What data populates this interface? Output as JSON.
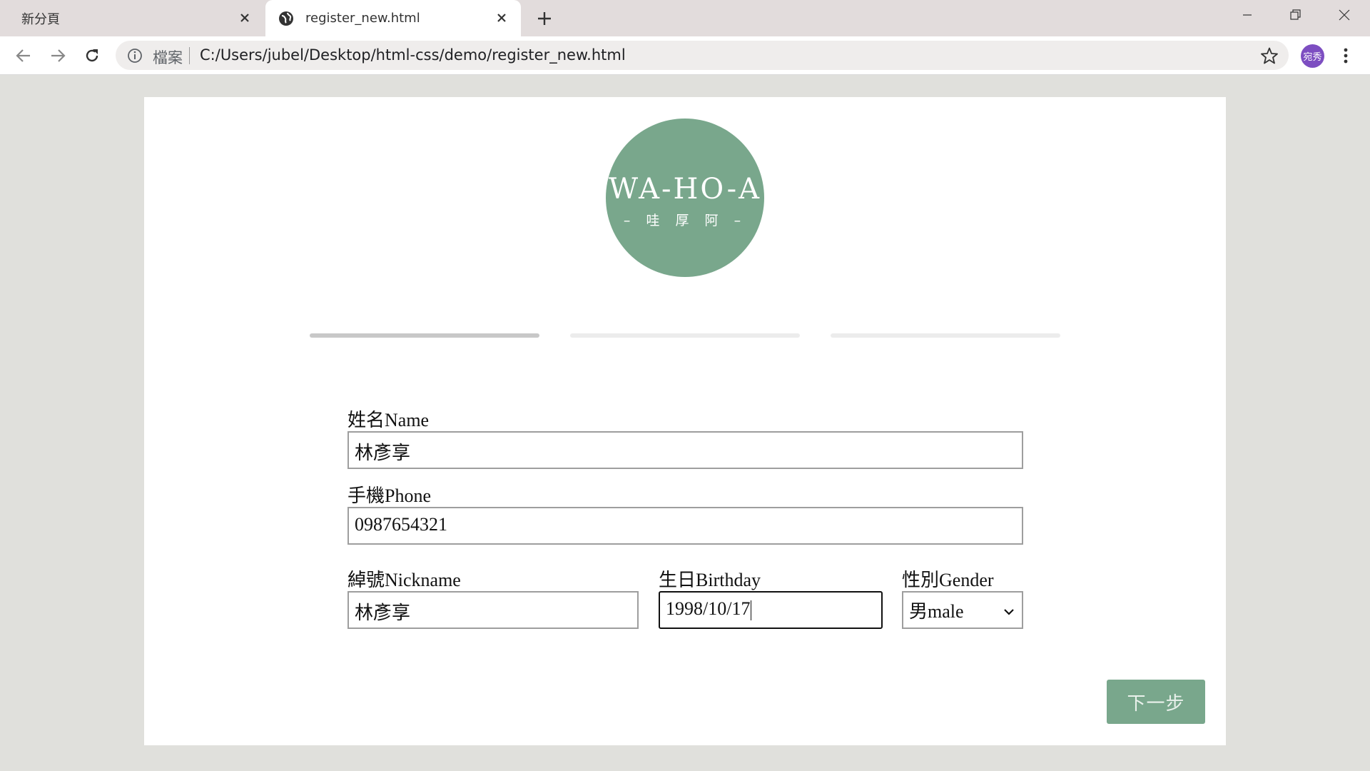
{
  "browser": {
    "tabs": [
      {
        "title": "新分頁",
        "active": false
      },
      {
        "title": "register_new.html",
        "active": true
      }
    ],
    "address": {
      "scheme_label": "檔案",
      "url": "C:/Users/jubel/Desktop/html-css/demo/register_new.html"
    },
    "profile_initials": "宛秀"
  },
  "page": {
    "logo": {
      "brand": "WA-HO-A",
      "subtitle": "– 哇 厚 阿 –",
      "color": "#79a78c"
    },
    "steps": {
      "total": 3,
      "current": 1
    },
    "form": {
      "name": {
        "label": "姓名Name",
        "value": "林彥享"
      },
      "phone": {
        "label": "手機Phone",
        "value": "0987654321"
      },
      "nickname": {
        "label": "綽號Nickname",
        "value": "林彥享"
      },
      "birthday": {
        "label": "生日Birthday",
        "value": "1998/10/17"
      },
      "gender": {
        "label": "性別Gender",
        "value": "男male"
      }
    },
    "next_button": {
      "label": "下一步"
    }
  },
  "colors": {
    "accent": "#79a78c",
    "page_bg": "#e0e0dc",
    "card_bg": "#ffffff",
    "tabstrip": "#e2dcdc"
  }
}
